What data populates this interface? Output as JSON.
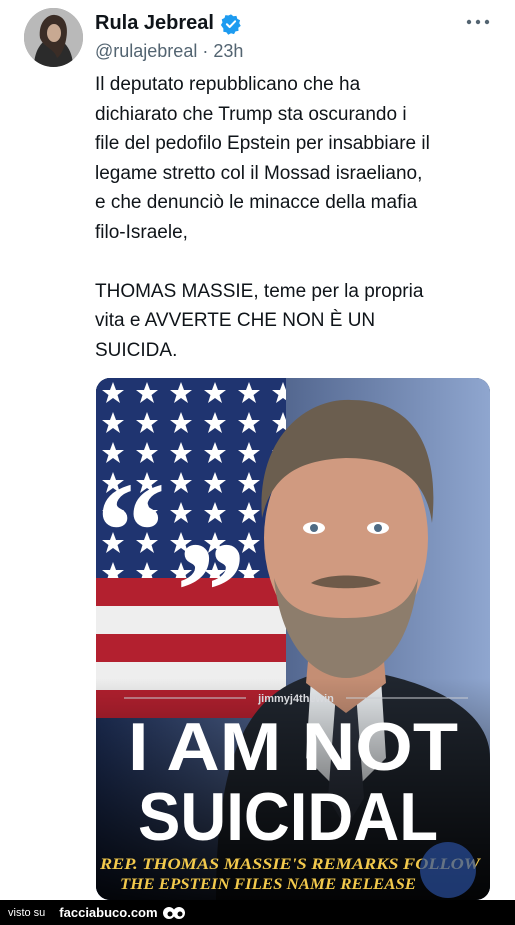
{
  "tweet": {
    "display_name": "Rula Jebreal",
    "handle": "@rulajebreal",
    "separator": "·",
    "time": "23h",
    "text": "Il deputato repubblicano che ha\ndichiarato che Trump sta  oscurando i\nfile del pedofilo Epstein per insabbiare il\nlegame stretto col il Mossad israeliano,\ne che denunciò le minacce della mafia\nfilo-Israele,\n\nTHOMAS MASSIE, teme per la propria\nvita e AVVERTE CHE NON È UN\nSUICIDA.",
    "verified_icon": "verified-badge-icon",
    "more_icon": "more-dots-icon"
  },
  "image": {
    "watermark": "jimmyj4thewin",
    "headline_line1": "I AM NOT",
    "headline_line2": "SUICIDAL",
    "caption_line1": "REP. THOMAS MASSIE'S REMARKS FOLLOW",
    "caption_line2": "THE EPSTEIN FILES NAME RELEASE",
    "quote_mark_open": "“",
    "quote_mark_close": "”"
  },
  "footer": {
    "visto_su": "visto su",
    "site": "facciabuco.com"
  },
  "colors": {
    "accent_blue": "#1d9bf0",
    "caption_yellow": "#f2c94c",
    "muted_text": "#536471"
  }
}
